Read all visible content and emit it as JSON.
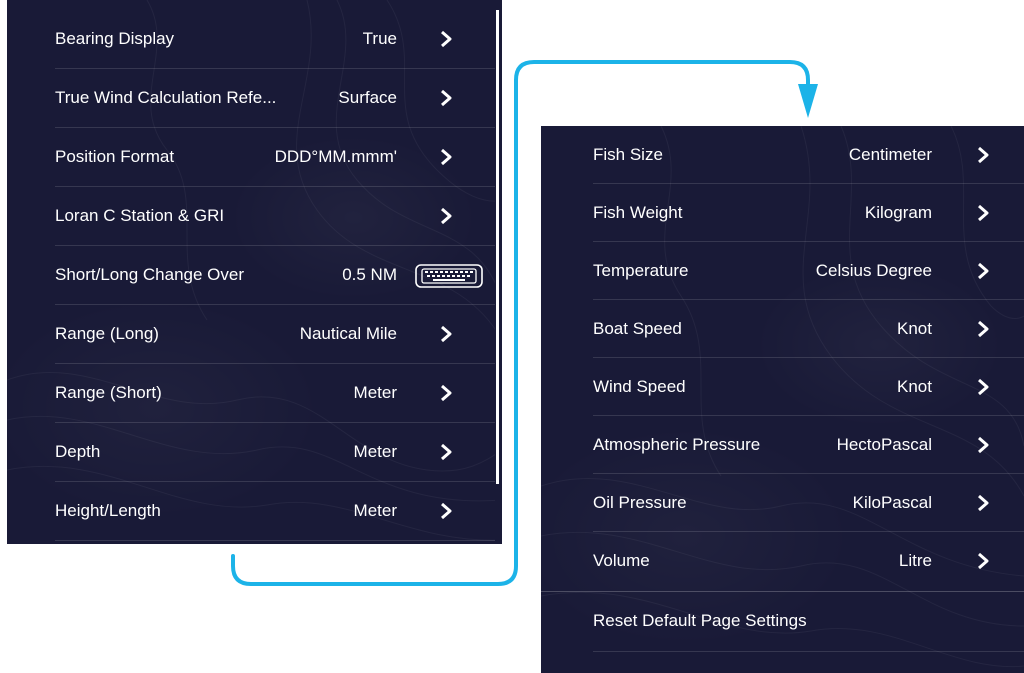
{
  "left_panel": {
    "rows": [
      {
        "label": "Bearing Display",
        "value": "True",
        "action": "chevron-right-icon"
      },
      {
        "label": "True Wind Calculation Refe...",
        "value": "Surface",
        "action": "chevron-right-icon"
      },
      {
        "label": "Position Format",
        "value": "DDD°MM.mmm'",
        "action": "chevron-right-icon"
      },
      {
        "label": "Loran C Station & GRI",
        "value": "",
        "action": "chevron-right-icon"
      },
      {
        "label": "Short/Long Change Over",
        "value": "0.5 NM",
        "action": "keyboard-icon"
      },
      {
        "label": "Range (Long)",
        "value": "Nautical Mile",
        "action": "chevron-right-icon"
      },
      {
        "label": "Range (Short)",
        "value": "Meter",
        "action": "chevron-right-icon"
      },
      {
        "label": "Depth",
        "value": "Meter",
        "action": "chevron-right-icon"
      },
      {
        "label": "Height/Length",
        "value": "Meter",
        "action": "chevron-right-icon"
      }
    ]
  },
  "right_panel": {
    "rows": [
      {
        "label": "Fish Size",
        "value": "Centimeter",
        "action": "chevron-right-icon"
      },
      {
        "label": "Fish Weight",
        "value": "Kilogram",
        "action": "chevron-right-icon"
      },
      {
        "label": "Temperature",
        "value": "Celsius Degree",
        "action": "chevron-right-icon"
      },
      {
        "label": "Boat Speed",
        "value": "Knot",
        "action": "chevron-right-icon"
      },
      {
        "label": "Wind Speed",
        "value": "Knot",
        "action": "chevron-right-icon"
      },
      {
        "label": "Atmospheric Pressure",
        "value": "HectoPascal",
        "action": "chevron-right-icon"
      },
      {
        "label": "Oil Pressure",
        "value": "KiloPascal",
        "action": "chevron-right-icon"
      },
      {
        "label": "Volume",
        "value": "Litre",
        "action": "chevron-right-icon"
      }
    ],
    "reset_label": "Reset Default Page Settings"
  },
  "colors": {
    "panel_background": "#191a37",
    "connector_arrow": "#1cb3e8",
    "text": "#ffffff"
  }
}
